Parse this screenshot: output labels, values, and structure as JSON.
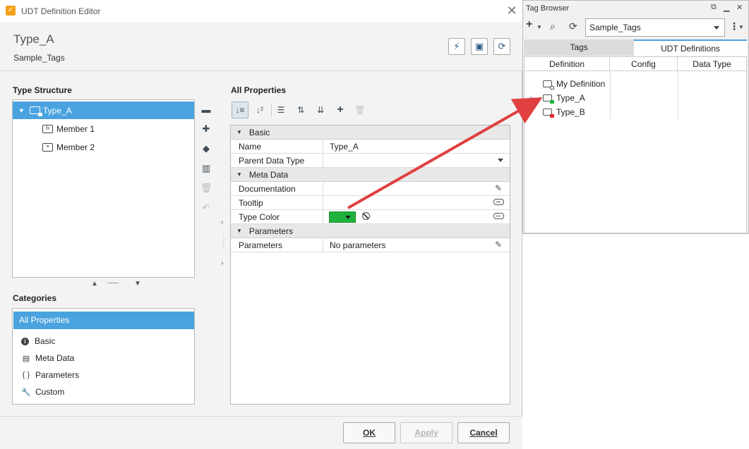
{
  "window": {
    "title": "UDT Definition Editor",
    "close_glyph": "✕"
  },
  "header": {
    "udt_name": "Type_A",
    "provider": "Sample_Tags",
    "buttons": [
      {
        "icon": "diagnostics-icon",
        "glyph": "⚡"
      },
      {
        "icon": "note-icon",
        "glyph": "▣"
      },
      {
        "icon": "refresh-icon",
        "glyph": "⟳"
      }
    ]
  },
  "type_structure": {
    "title": "Type Structure",
    "items": [
      {
        "label": "Type_A",
        "selected": true
      },
      {
        "label": "Member 1"
      },
      {
        "label": "Member 2"
      }
    ],
    "tools": [
      {
        "icon": "folder-icon",
        "glyph": "▬",
        "enabled": true
      },
      {
        "icon": "add-tag-icon",
        "glyph": "✚",
        "enabled": true
      },
      {
        "icon": "tag-icon",
        "glyph": "◆",
        "enabled": true
      },
      {
        "icon": "columns-icon",
        "glyph": "▥",
        "enabled": true
      },
      {
        "icon": "delete-icon",
        "glyph": "🗑",
        "enabled": false
      },
      {
        "icon": "undo-icon",
        "glyph": "↶",
        "enabled": false
      }
    ]
  },
  "categories": {
    "title": "Categories",
    "selected": "All Properties",
    "items": [
      {
        "label": "Basic",
        "icon": "info-icon",
        "glyph": "i"
      },
      {
        "label": "Meta Data",
        "icon": "database-icon",
        "glyph": "▤"
      },
      {
        "label": "Parameters",
        "icon": "braces-icon",
        "glyph": "{ }"
      },
      {
        "label": "Custom",
        "icon": "wrench-icon",
        "glyph": "🔧"
      }
    ]
  },
  "properties": {
    "title": "All Properties",
    "groups": {
      "basic": "Basic",
      "meta": "Meta Data",
      "params": "Parameters"
    },
    "rows": {
      "name": {
        "label": "Name",
        "value": "Type_A"
      },
      "parent": {
        "label": "Parent Data Type",
        "value": ""
      },
      "documentation": {
        "label": "Documentation",
        "value": ""
      },
      "tooltip": {
        "label": "Tooltip",
        "value": ""
      },
      "type_color": {
        "label": "Type Color",
        "color": "#1fb33b"
      },
      "parameters": {
        "label": "Parameters",
        "value": "No parameters"
      }
    }
  },
  "footer": {
    "ok": "OK",
    "apply": "Apply",
    "cancel": "Cancel"
  },
  "tag_browser": {
    "title": "Tag Browser",
    "provider": "Sample_Tags",
    "tabs": {
      "tags": "Tags",
      "udt": "UDT Definitions"
    },
    "columns": {
      "definition": "Definition",
      "config": "Config",
      "data_type": "Data Type"
    },
    "rows": [
      {
        "label": "My Definition",
        "accent": "#ffffff"
      },
      {
        "label": "Type_A",
        "accent": "#1fb33b"
      },
      {
        "label": "Type_B",
        "accent": "#e0262c"
      }
    ]
  },
  "accent_color": "#4aa3df",
  "arrow_color": "#e04040"
}
